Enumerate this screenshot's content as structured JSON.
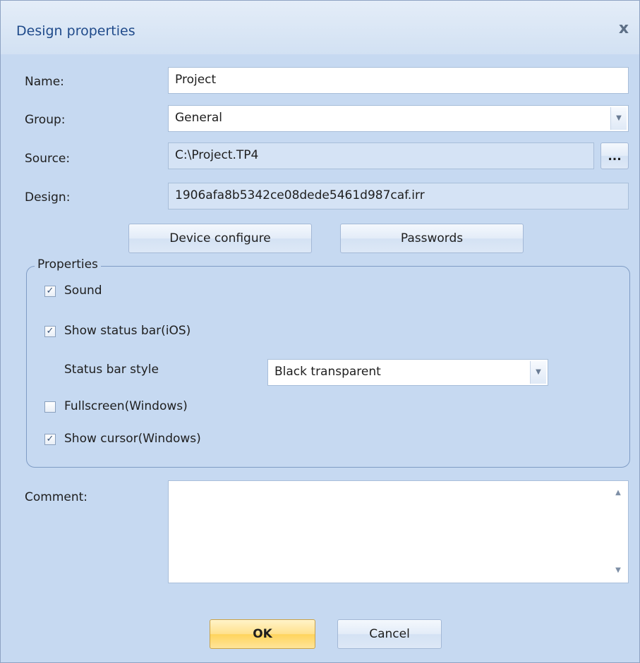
{
  "dialog": {
    "title": "Design properties",
    "close_glyph": "x"
  },
  "form": {
    "name_label": "Name:",
    "name_value": "Project",
    "group_label": "Group:",
    "group_value": "General",
    "source_label": "Source:",
    "source_value": "C:\\Project.TP4",
    "browse_label": "...",
    "design_label": "Design:",
    "design_value": "1906afa8b5342ce08dede5461d987caf.irr"
  },
  "buttons": {
    "device_configure": "Device configure",
    "passwords": "Passwords",
    "ok": "OK",
    "cancel": "Cancel"
  },
  "properties": {
    "legend": "Properties",
    "sound": {
      "label": "Sound",
      "checked": true
    },
    "show_status_bar": {
      "label": "Show status bar(iOS)",
      "checked": true
    },
    "status_bar_style_label": "Status bar style",
    "status_bar_style_value": "Black transparent",
    "fullscreen": {
      "label": "Fullscreen(Windows)",
      "checked": false
    },
    "show_cursor": {
      "label": "Show cursor(Windows)",
      "checked": true
    }
  },
  "comment": {
    "label": "Comment:",
    "value": ""
  },
  "colors": {
    "dialog_bg": "#c6d9f1",
    "title_text": "#1f4a8a",
    "ok_button": "#ffd45c"
  }
}
